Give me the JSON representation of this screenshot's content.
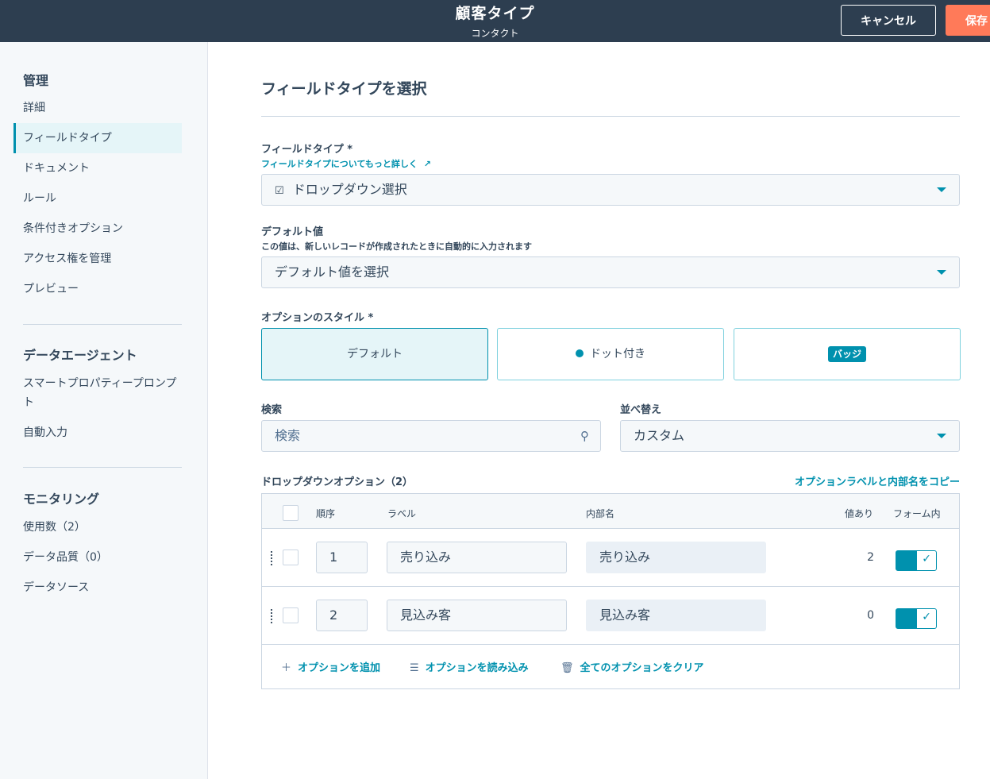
{
  "header": {
    "title": "顧客タイプ",
    "subtitle": "コンタクト",
    "cancel_label": "キャンセル",
    "save_label": "保存"
  },
  "sidebar": {
    "sections": [
      {
        "heading": "管理",
        "items": [
          {
            "label": "詳細",
            "active": false
          },
          {
            "label": "フィールドタイプ",
            "active": true
          },
          {
            "label": "ドキュメント",
            "active": false
          },
          {
            "label": "ルール",
            "active": false
          },
          {
            "label": "条件付きオプション",
            "active": false
          },
          {
            "label": "アクセス権を管理",
            "active": false
          },
          {
            "label": "プレビュー",
            "active": false
          }
        ]
      },
      {
        "heading": "データエージェント",
        "items": [
          {
            "label": "スマートプロパティープロンプト",
            "active": false
          },
          {
            "label": "自動入力",
            "active": false
          }
        ]
      },
      {
        "heading": "モニタリング",
        "items": [
          {
            "label": "使用数（2）",
            "active": false
          },
          {
            "label": "データ品質（0）",
            "active": false
          },
          {
            "label": "データソース",
            "active": false
          }
        ]
      }
    ]
  },
  "main": {
    "title": "フィールドタイプを選択",
    "field_type": {
      "label": "フィールドタイプ *",
      "help_link": "フィールドタイプについてもっと詳しく",
      "value": "ドロップダウン選択"
    },
    "default_value": {
      "label": "デフォルト値",
      "help": "この値は、新しいレコードが作成されたときに自動的に入力されます",
      "placeholder": "デフォルト値を選択"
    },
    "option_style": {
      "label": "オプションのスタイル *",
      "options": [
        {
          "label": "デフォルト",
          "selected": true
        },
        {
          "label": "ドット付き",
          "selected": false
        },
        {
          "label": "バッジ",
          "selected": false
        }
      ]
    },
    "search": {
      "label": "検索",
      "placeholder": "検索"
    },
    "sort": {
      "label": "並べ替え",
      "value": "カスタム"
    },
    "options": {
      "heading": "ドロップダウンオプション（2）",
      "copy_link": "オプションラベルと内部名をコピー",
      "columns": {
        "order": "順序",
        "label": "ラベル",
        "internal": "内部名",
        "has_value": "値あり",
        "in_form": "フォーム内"
      },
      "rows": [
        {
          "order": "1",
          "label": "売り込み",
          "internal": "売り込み",
          "count": "2",
          "in_form": true
        },
        {
          "order": "2",
          "label": "見込み客",
          "internal": "見込み客",
          "count": "0",
          "in_form": true
        }
      ],
      "actions": {
        "add": "オプションを追加",
        "import": "オプションを読み込み",
        "clear": "全てのオプションをクリア"
      }
    }
  },
  "colors": {
    "header_bg": "#2d3e50",
    "accent": "#0091ae",
    "save_button": "#ff7a59"
  }
}
